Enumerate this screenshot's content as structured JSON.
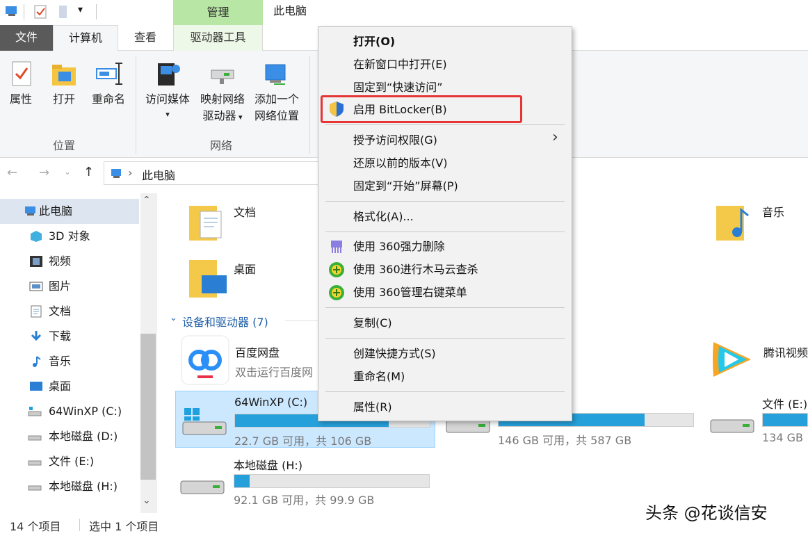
{
  "titlebar": {
    "manage_tab": "管理",
    "window_title": "此电脑"
  },
  "ribbon_tabs": {
    "file": "文件",
    "computer": "计算机",
    "view": "查看",
    "drive_tools": "驱动器工具"
  },
  "ribbon": {
    "location_group": {
      "label": "位置",
      "properties": "属性",
      "open": "打开",
      "rename": "重命名"
    },
    "network_group": {
      "label": "网络",
      "access_media": "访问媒体",
      "map_drive_line1": "映射网络",
      "map_drive_line2": "驱动器",
      "add_location_line1": "添加一个",
      "add_location_line2": "网络位置"
    }
  },
  "address": {
    "path": "此电脑"
  },
  "nav": {
    "items": [
      {
        "label": "此电脑"
      },
      {
        "label": "3D 对象"
      },
      {
        "label": "视频"
      },
      {
        "label": "图片"
      },
      {
        "label": "文档"
      },
      {
        "label": "下载"
      },
      {
        "label": "音乐"
      },
      {
        "label": "桌面"
      },
      {
        "label": "64WinXP  (C:)"
      },
      {
        "label": "本地磁盘 (D:)"
      },
      {
        "label": "文件 (E:)"
      },
      {
        "label": "本地磁盘 (H:)"
      }
    ]
  },
  "folders": {
    "documents": "文档",
    "music": "音乐",
    "desktop": "桌面"
  },
  "devices": {
    "header": "设备和驱动器 (7)",
    "baidu": {
      "name": "百度网盘",
      "sub": "双击运行百度网"
    },
    "tencent": {
      "name": "腾讯视频"
    },
    "drive_c": {
      "name": "64WinXP  (C:)",
      "info": "22.7 GB 可用，共 106 GB",
      "used_fraction": 0.79
    },
    "drive_d": {
      "info": "146 GB 可用，共 587 GB",
      "used_fraction": 0.75
    },
    "drive_e": {
      "name": "文件 (E:)",
      "info": "134 GB",
      "used_fraction": 1.0
    },
    "drive_h": {
      "name": "本地磁盘 (H:)",
      "info": "92.1 GB 可用，共 99.9 GB",
      "used_fraction": 0.08
    }
  },
  "context_menu": {
    "open": "打开(O)",
    "open_new_window": "在新窗口中打开(E)",
    "pin_quick_access": "固定到“快速访问”",
    "bitlocker": "启用 BitLocker(B)",
    "give_access": "授予访问权限(G)",
    "restore_versions": "还原以前的版本(V)",
    "pin_start": "固定到“开始”屏幕(P)",
    "format": "格式化(A)...",
    "del_360": "使用 360强力删除",
    "scan_360": "使用 360进行木马云查杀",
    "menu_360": "使用 360管理右键菜单",
    "copy": "复制(C)",
    "shortcut": "创建快捷方式(S)",
    "rename": "重命名(M)",
    "properties": "属性(R)"
  },
  "status": {
    "count": "14 个项目",
    "selected": "选中 1 个项目"
  },
  "watermark": "头条 @花谈信安",
  "colors": {
    "accent": "#26a0da",
    "manage_tab": "#b8e6a4",
    "highlight": "#e53535"
  }
}
